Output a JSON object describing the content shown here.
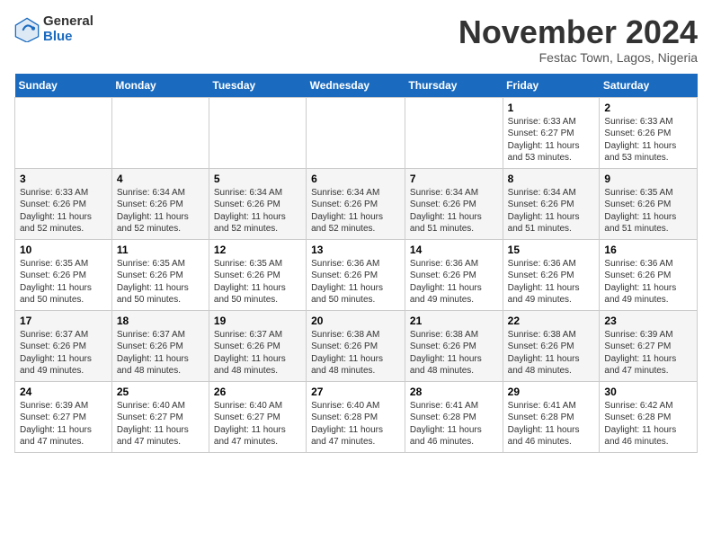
{
  "logo": {
    "general": "General",
    "blue": "Blue"
  },
  "title": "November 2024",
  "subtitle": "Festac Town, Lagos, Nigeria",
  "days_of_week": [
    "Sunday",
    "Monday",
    "Tuesday",
    "Wednesday",
    "Thursday",
    "Friday",
    "Saturday"
  ],
  "weeks": [
    [
      {
        "day": "",
        "info": ""
      },
      {
        "day": "",
        "info": ""
      },
      {
        "day": "",
        "info": ""
      },
      {
        "day": "",
        "info": ""
      },
      {
        "day": "",
        "info": ""
      },
      {
        "day": "1",
        "info": "Sunrise: 6:33 AM\nSunset: 6:27 PM\nDaylight: 11 hours\nand 53 minutes."
      },
      {
        "day": "2",
        "info": "Sunrise: 6:33 AM\nSunset: 6:26 PM\nDaylight: 11 hours\nand 53 minutes."
      }
    ],
    [
      {
        "day": "3",
        "info": "Sunrise: 6:33 AM\nSunset: 6:26 PM\nDaylight: 11 hours\nand 52 minutes."
      },
      {
        "day": "4",
        "info": "Sunrise: 6:34 AM\nSunset: 6:26 PM\nDaylight: 11 hours\nand 52 minutes."
      },
      {
        "day": "5",
        "info": "Sunrise: 6:34 AM\nSunset: 6:26 PM\nDaylight: 11 hours\nand 52 minutes."
      },
      {
        "day": "6",
        "info": "Sunrise: 6:34 AM\nSunset: 6:26 PM\nDaylight: 11 hours\nand 52 minutes."
      },
      {
        "day": "7",
        "info": "Sunrise: 6:34 AM\nSunset: 6:26 PM\nDaylight: 11 hours\nand 51 minutes."
      },
      {
        "day": "8",
        "info": "Sunrise: 6:34 AM\nSunset: 6:26 PM\nDaylight: 11 hours\nand 51 minutes."
      },
      {
        "day": "9",
        "info": "Sunrise: 6:35 AM\nSunset: 6:26 PM\nDaylight: 11 hours\nand 51 minutes."
      }
    ],
    [
      {
        "day": "10",
        "info": "Sunrise: 6:35 AM\nSunset: 6:26 PM\nDaylight: 11 hours\nand 50 minutes."
      },
      {
        "day": "11",
        "info": "Sunrise: 6:35 AM\nSunset: 6:26 PM\nDaylight: 11 hours\nand 50 minutes."
      },
      {
        "day": "12",
        "info": "Sunrise: 6:35 AM\nSunset: 6:26 PM\nDaylight: 11 hours\nand 50 minutes."
      },
      {
        "day": "13",
        "info": "Sunrise: 6:36 AM\nSunset: 6:26 PM\nDaylight: 11 hours\nand 50 minutes."
      },
      {
        "day": "14",
        "info": "Sunrise: 6:36 AM\nSunset: 6:26 PM\nDaylight: 11 hours\nand 49 minutes."
      },
      {
        "day": "15",
        "info": "Sunrise: 6:36 AM\nSunset: 6:26 PM\nDaylight: 11 hours\nand 49 minutes."
      },
      {
        "day": "16",
        "info": "Sunrise: 6:36 AM\nSunset: 6:26 PM\nDaylight: 11 hours\nand 49 minutes."
      }
    ],
    [
      {
        "day": "17",
        "info": "Sunrise: 6:37 AM\nSunset: 6:26 PM\nDaylight: 11 hours\nand 49 minutes."
      },
      {
        "day": "18",
        "info": "Sunrise: 6:37 AM\nSunset: 6:26 PM\nDaylight: 11 hours\nand 48 minutes."
      },
      {
        "day": "19",
        "info": "Sunrise: 6:37 AM\nSunset: 6:26 PM\nDaylight: 11 hours\nand 48 minutes."
      },
      {
        "day": "20",
        "info": "Sunrise: 6:38 AM\nSunset: 6:26 PM\nDaylight: 11 hours\nand 48 minutes."
      },
      {
        "day": "21",
        "info": "Sunrise: 6:38 AM\nSunset: 6:26 PM\nDaylight: 11 hours\nand 48 minutes."
      },
      {
        "day": "22",
        "info": "Sunrise: 6:38 AM\nSunset: 6:26 PM\nDaylight: 11 hours\nand 48 minutes."
      },
      {
        "day": "23",
        "info": "Sunrise: 6:39 AM\nSunset: 6:27 PM\nDaylight: 11 hours\nand 47 minutes."
      }
    ],
    [
      {
        "day": "24",
        "info": "Sunrise: 6:39 AM\nSunset: 6:27 PM\nDaylight: 11 hours\nand 47 minutes."
      },
      {
        "day": "25",
        "info": "Sunrise: 6:40 AM\nSunset: 6:27 PM\nDaylight: 11 hours\nand 47 minutes."
      },
      {
        "day": "26",
        "info": "Sunrise: 6:40 AM\nSunset: 6:27 PM\nDaylight: 11 hours\nand 47 minutes."
      },
      {
        "day": "27",
        "info": "Sunrise: 6:40 AM\nSunset: 6:28 PM\nDaylight: 11 hours\nand 47 minutes."
      },
      {
        "day": "28",
        "info": "Sunrise: 6:41 AM\nSunset: 6:28 PM\nDaylight: 11 hours\nand 46 minutes."
      },
      {
        "day": "29",
        "info": "Sunrise: 6:41 AM\nSunset: 6:28 PM\nDaylight: 11 hours\nand 46 minutes."
      },
      {
        "day": "30",
        "info": "Sunrise: 6:42 AM\nSunset: 6:28 PM\nDaylight: 11 hours\nand 46 minutes."
      }
    ]
  ]
}
